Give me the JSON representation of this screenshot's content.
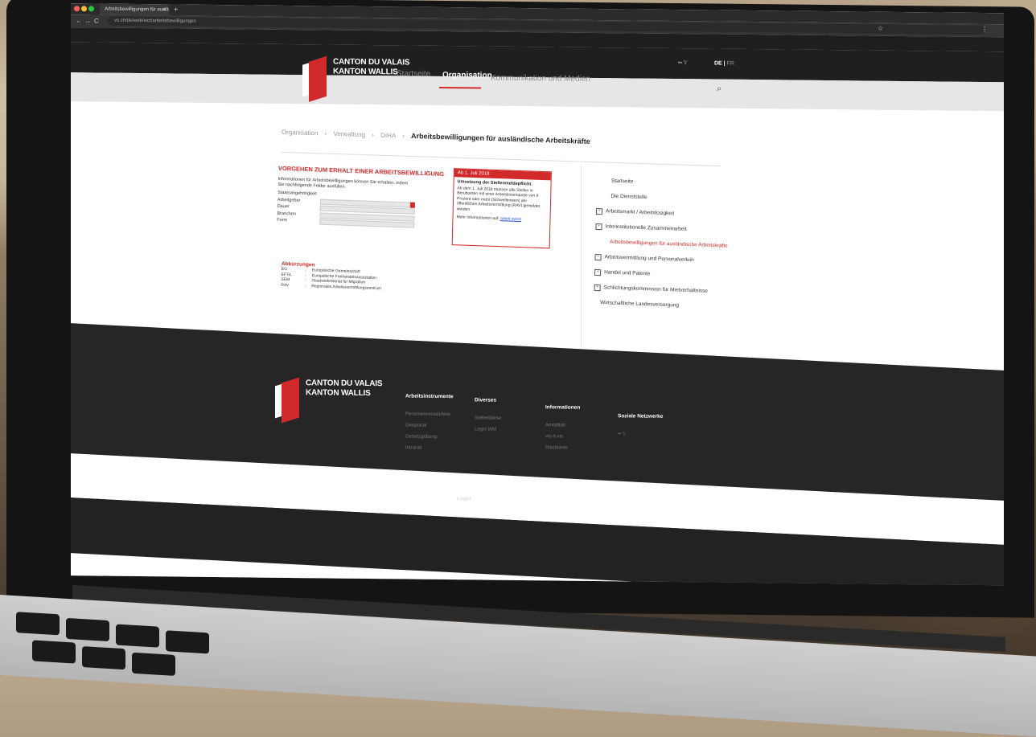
{
  "browser": {
    "tab_title": "Arbeitsbewilligungen für auslä",
    "tab_close": "×",
    "new_tab": "+",
    "url": "vs.ch/de/web/sict/arbeitsbewilligungen",
    "back": "←",
    "forward": "→",
    "reload": "C",
    "bookmark_icon": "☆",
    "menu_icon": "⋮"
  },
  "header": {
    "logo_line1": "CANTON DU VALAIS",
    "logo_line2": "KANTON WALLIS",
    "nav": [
      "Startseite",
      "Organisation",
      "Kommunikation und Medien"
    ],
    "social_icons": "•• 𝕐",
    "lang_active": "DE",
    "lang_sep": " | ",
    "lang_other": "FR",
    "search_icon": "⌕"
  },
  "breadcrumb": {
    "items": [
      "Organisation",
      "Verwaltung",
      "DIHA"
    ],
    "current": "Arbeitsbewilligungen für ausländische Arbeitskräfte",
    "sep": "›"
  },
  "form": {
    "title": "VORGEHEN ZUM ERHALT EINER ARBEITSBEWILLIGUNG",
    "intro": "Informationen für Arbeitsbewilligungen können Sie erhalten, indem Sie nachfolgende Felder ausfüllen.",
    "fields": [
      "Staatsangehörigkeit",
      "Arbeitgeber",
      "Dauer",
      "Branchen",
      "Form"
    ]
  },
  "notice": {
    "head": "Ab 1. Juli 2018",
    "subtitle": "Umsetzung der Stellenmeldepflicht.",
    "body": "Ab dem 1. Juli 2018 müssen alle Stellen in Berufsarten mit einer Arbeitslosenquote von 8 Prozent oder mehr (Schwellenwert) der öffentlichen Arbeitsvermittlung (RAV) gemeldet werden.",
    "more": "Mehr Informationen auf: ",
    "link": "arbeit.swiss"
  },
  "abbreviations": {
    "title": "Abkürzungen",
    "rows": [
      {
        "k": "EG",
        "v": "Europäische Gemeinschaft"
      },
      {
        "k": "EFTA",
        "v": "Europäische Freihandelsassoziation"
      },
      {
        "k": "SEM",
        "v": "Staatssekretariat für Migration"
      },
      {
        "k": "RAV",
        "v": "Regionales Arbeitsvermittlungszentrum"
      }
    ]
  },
  "sidenav": {
    "items": [
      {
        "label": "Startseite",
        "type": "plain"
      },
      {
        "label": "Die Dienststelle",
        "type": "plain"
      },
      {
        "label": "Arbeitsmarkt / Arbeitslosigkeit",
        "type": "box"
      },
      {
        "label": "Interinstitutionelle Zusammenarbeit",
        "type": "box"
      },
      {
        "label": "Arbeitsbewilligungen für ausländische Arbeitskräfte",
        "type": "active"
      },
      {
        "label": "Arbeitsvermittlung und Personalverleih",
        "type": "box"
      },
      {
        "label": "Handel und Patente",
        "type": "box"
      },
      {
        "label": "Schlichtungskommission für Mietverhältnisse",
        "type": "box"
      },
      {
        "label": "Wirtschaftliche Landesversorgung",
        "type": "plain"
      }
    ],
    "box_glyph": "+"
  },
  "footer": {
    "logo_line1": "CANTON DU VALAIS",
    "logo_line2": "KANTON WALLIS",
    "columns": [
      {
        "title": "Arbeitsinstrumente",
        "items": [
          "Personenverzeichnis",
          "Geoportal",
          "Gesetzgebung",
          "Intranet"
        ]
      },
      {
        "title": "Diverses",
        "items": [
          "Stellenbörse",
          "Login IAM"
        ]
      },
      {
        "title": "Informationen",
        "items": [
          "Amtsblatt",
          "vis-à-vis",
          "Disclaimer"
        ]
      },
      {
        "title": "Soziale Netzwerke",
        "items": [
          "•• 𝕐"
        ]
      }
    ],
    "login": "Login"
  },
  "colors": {
    "accent": "#d22a2a",
    "header_bg": "#1f1f1f",
    "footer_bg": "#262626"
  }
}
